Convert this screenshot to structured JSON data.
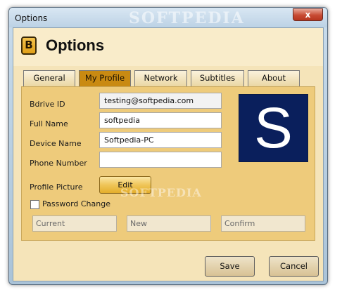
{
  "window": {
    "title": "Options",
    "close_glyph": "x",
    "watermark": "SOFTPEDIA"
  },
  "header": {
    "logo_letter": "B",
    "title": "Options"
  },
  "tabs": [
    {
      "label": "General"
    },
    {
      "label": "My Profile",
      "active": true
    },
    {
      "label": "Network"
    },
    {
      "label": "Subtitles"
    },
    {
      "label": "About"
    }
  ],
  "profile": {
    "bdrive_id_label": "Bdrive ID",
    "bdrive_id_value": "testing@softpedia.com",
    "full_name_label": "Full Name",
    "full_name_value": "softpedia",
    "device_name_label": "Device Name",
    "device_name_value": "Softpedia-PC",
    "phone_label": "Phone Number",
    "phone_value": "",
    "picture_label": "Profile Picture",
    "edit_label": "Edit",
    "avatar_letter": "S",
    "watermark": "SOFTPEDIA"
  },
  "password": {
    "checkbox_label": "Password Change",
    "checked": false,
    "current_placeholder": "Current",
    "new_placeholder": "New",
    "confirm_placeholder": "Confirm"
  },
  "footer": {
    "save_label": "Save",
    "cancel_label": "Cancel"
  },
  "colors": {
    "accent": "#c98a12",
    "panel": "#eecb7b",
    "avatar_bg": "#0a1f5c"
  }
}
